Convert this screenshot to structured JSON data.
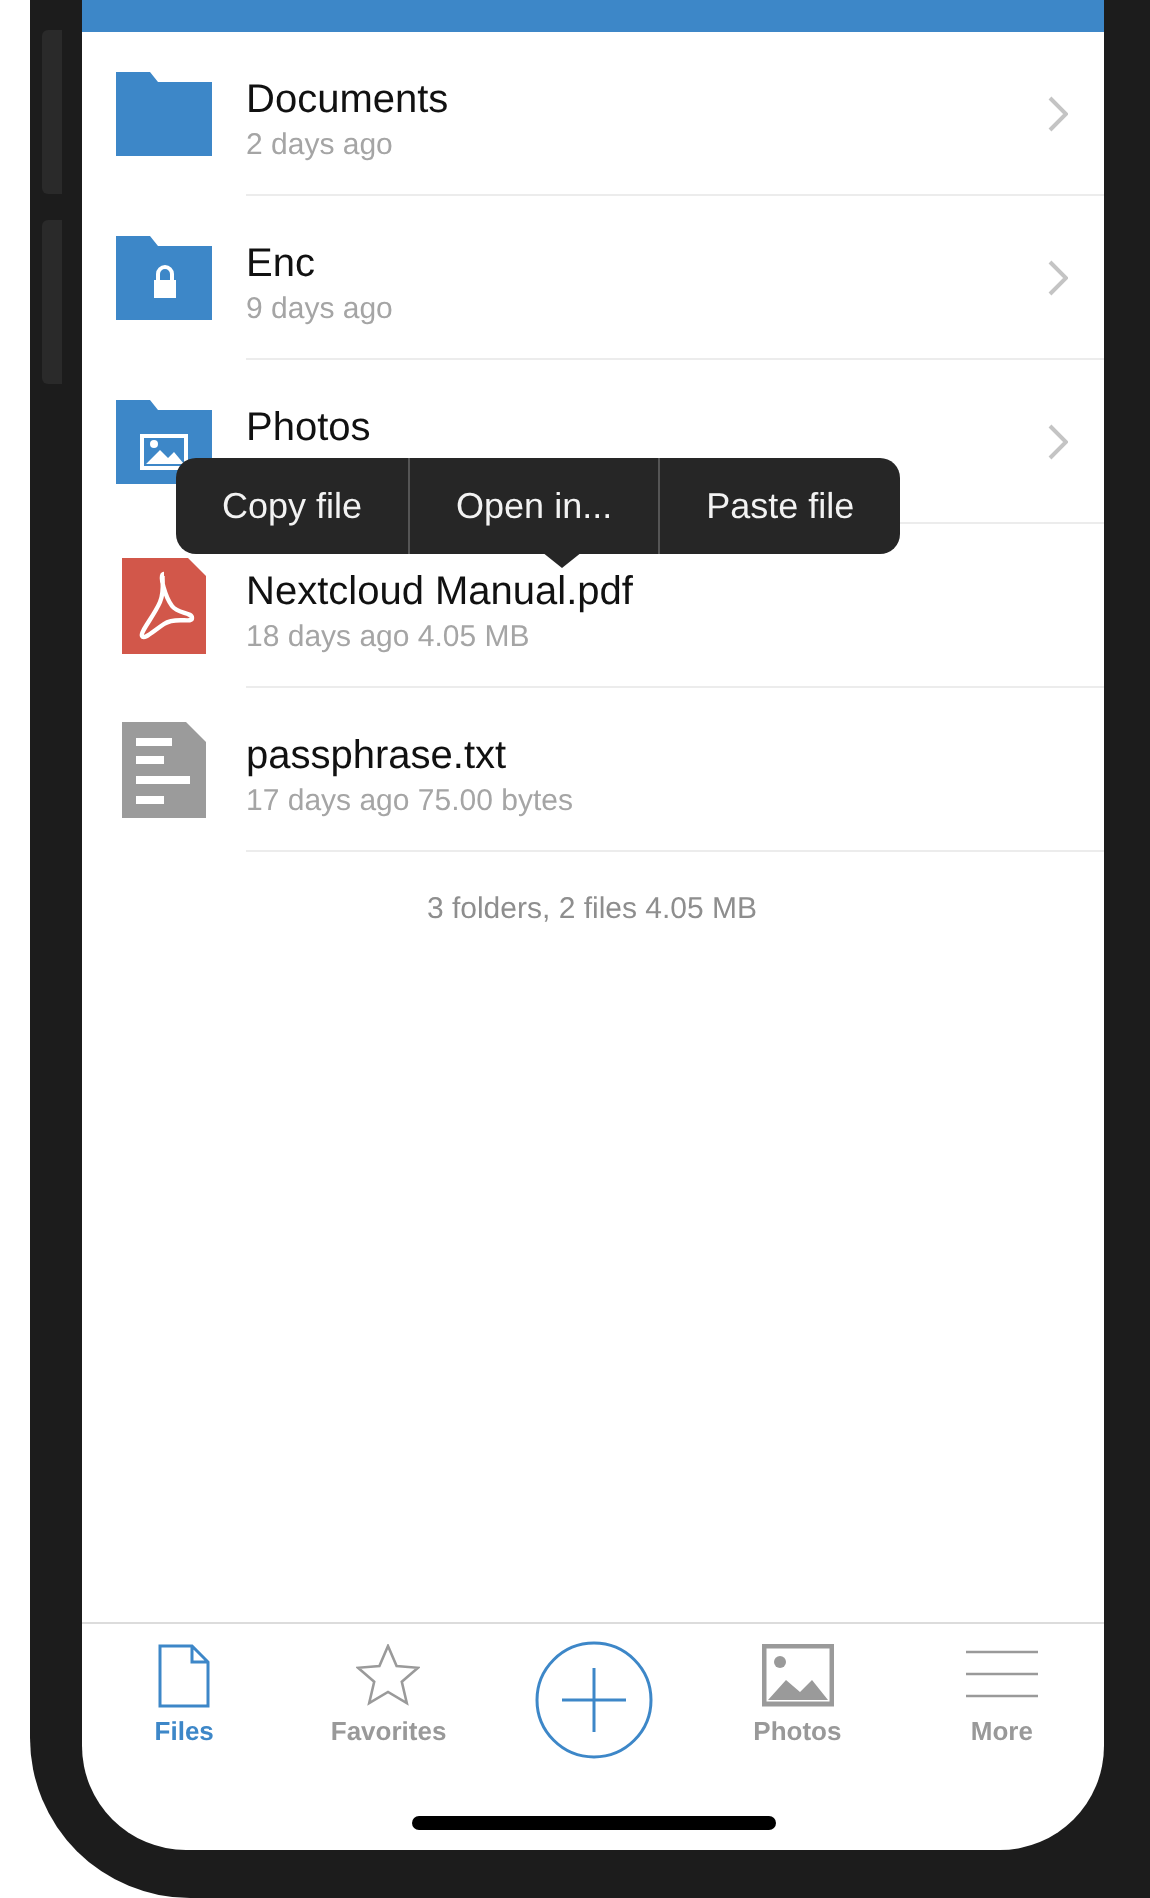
{
  "files": [
    {
      "kind": "folder",
      "name": "Documents",
      "subtitle": "2 days ago"
    },
    {
      "kind": "lockedfolder",
      "name": "Enc",
      "subtitle": "9 days ago"
    },
    {
      "kind": "imagefolder",
      "name": "Photos"
    },
    {
      "kind": "pdf",
      "name": "Nextcloud Manual.pdf",
      "subtitle": "18 days ago 4.05 MB"
    },
    {
      "kind": "text",
      "name": "passphrase.txt",
      "subtitle": "17 days ago 75.00 bytes"
    }
  ],
  "summary": "3 folders, 2 files 4.05 MB",
  "context_menu": [
    "Copy file",
    "Open in...",
    "Paste file"
  ],
  "tabs": [
    {
      "kind": "files",
      "label": "Files",
      "selected": true
    },
    {
      "kind": "favorites",
      "label": "Favorites",
      "selected": false
    },
    {
      "kind": "add"
    },
    {
      "kind": "photos",
      "label": "Photos",
      "selected": false
    },
    {
      "kind": "more",
      "label": "More",
      "selected": false
    }
  ]
}
